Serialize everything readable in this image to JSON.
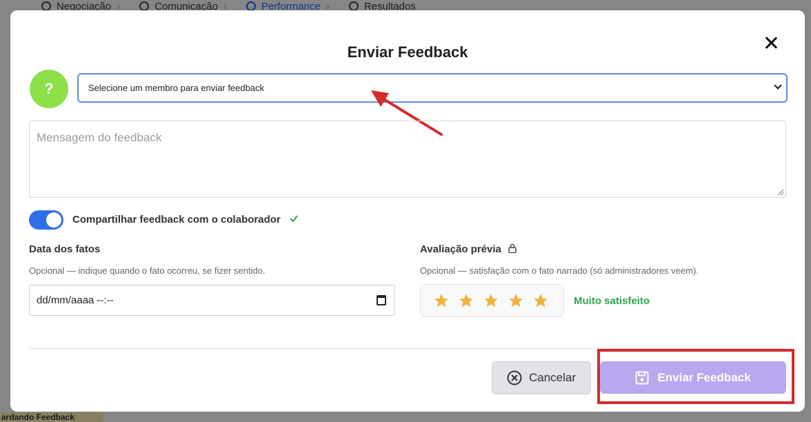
{
  "background": {
    "tabs": [
      {
        "label": "Negociação"
      },
      {
        "label": "Comunicação"
      },
      {
        "label": "Performance",
        "active": true
      },
      {
        "label": "Resultados"
      }
    ],
    "bottom_badge": "ardando Feedback"
  },
  "modal": {
    "title": "Enviar Feedback",
    "avatar_symbol": "?",
    "member_select": {
      "selected": "Selecione um membro para enviar feedback"
    },
    "message": {
      "placeholder": "Mensagem do feedback"
    },
    "share_toggle": {
      "label": "Compartilhar feedback com o colaborador",
      "on": true
    },
    "date": {
      "label": "Data dos fatos",
      "help": "Opcional — indique quando o fato ocorreu, se fizer sentido.",
      "value": "dd/mm/aaaa --:--"
    },
    "rating": {
      "label": "Avaliação prévia",
      "help": "Opcional — satisfação com o fato narrado (só administradores veem).",
      "stars": 5,
      "max": 5,
      "text": "Muito satisfeito"
    },
    "buttons": {
      "cancel": "Cancelar",
      "send": "Enviar Feedback"
    }
  },
  "colors": {
    "accent": "#2f6fe6",
    "avatar": "#8ee04a",
    "send_button": "#b9a8f0",
    "rating_text": "#2ea44f",
    "star": "#f2b33d",
    "annotation": "#d42b2b"
  },
  "icons": [
    "close-icon",
    "chevron-down-icon",
    "check-icon",
    "lock-icon",
    "star-icon",
    "calendar-icon",
    "x-circle-icon",
    "save-icon"
  ]
}
